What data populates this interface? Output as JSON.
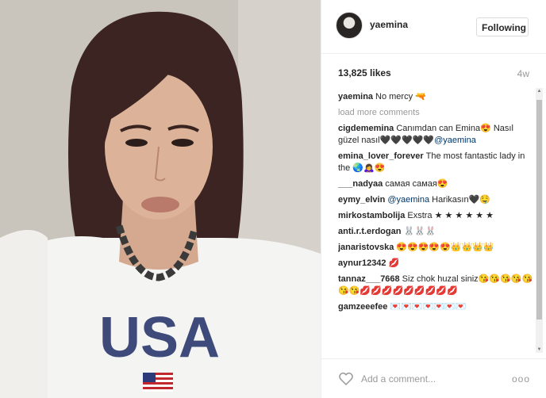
{
  "post": {
    "username": "yaemina",
    "follow_label": "Following",
    "likes": "13,825 likes",
    "age": "4w",
    "caption_user": "yaemina",
    "caption_text": "No mercy 🔫",
    "load_more": "load more comments"
  },
  "comments": [
    {
      "user": "cigdememina",
      "text": "Canımdan can Emina😍 Nasıl güzel nasıl🖤🖤🖤🖤🖤",
      "mention": "@yaemina"
    },
    {
      "user": "emina_lover_forever",
      "text": "The most fantastic lady in the 🌏🙇‍♀️😍",
      "mention": ""
    },
    {
      "user": "___nadyaa",
      "text": "самая самая😍",
      "mention": ""
    },
    {
      "user": "eymy_elvin",
      "text": "",
      "mention": "@yaemina",
      "after": " Harikasın🖤🤤"
    },
    {
      "user": "mirkostambolija",
      "text": "Exstra ★ ★ ★ ★ ★ ★",
      "mention": ""
    },
    {
      "user": "anti.r.t.erdogan",
      "text": "🐰🐰🐰",
      "mention": ""
    },
    {
      "user": "janaristovska",
      "text": "😍😍😍😍😍👑👑👑👑",
      "mention": ""
    },
    {
      "user": "aynur12342",
      "text": "💋",
      "mention": ""
    },
    {
      "user": "tannaz___7668",
      "text": "Siz chok huzal siniz😘😘😘😘😘😘😘💋💋💋💋💋💋💋💋💋",
      "mention": ""
    },
    {
      "user": "gamzeeefee",
      "text": "💌💌💌💌💌💌💌",
      "mention": ""
    }
  ],
  "footer": {
    "comment_placeholder": "Add a comment...",
    "more_label": "ooo"
  },
  "icons": {
    "heart": "heart-icon",
    "more": "more-options-icon",
    "avatar": "avatar"
  },
  "colors": {
    "mention": "#003569",
    "muted": "#999999",
    "border": "#efefef"
  }
}
